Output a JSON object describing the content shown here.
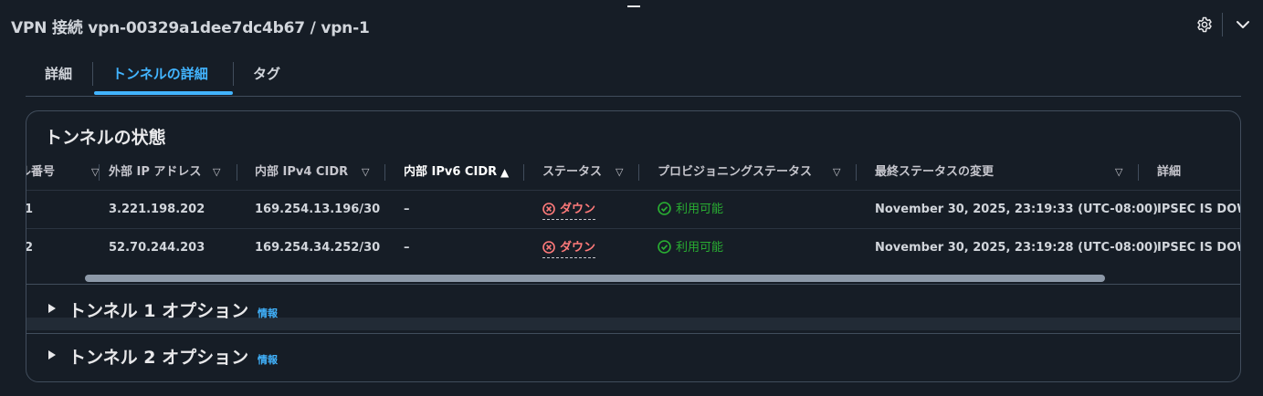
{
  "header": {
    "title": "VPN 接続 vpn-00329a1dee7dc4b67 / vpn-1",
    "icons": [
      "gear-icon",
      "chevron-down-icon"
    ]
  },
  "tabs": [
    {
      "label": "詳細"
    },
    {
      "label": "トンネルの詳細",
      "active": true
    },
    {
      "label": "タグ"
    }
  ],
  "tunnel_state": {
    "title": "トンネルの状態",
    "columns": [
      {
        "label": "ル番号"
      },
      {
        "label": "外部 IP アドレス"
      },
      {
        "label": "内部 IPv4 CIDR"
      },
      {
        "label": "内部 IPv6 CIDR",
        "sorted": "ascending"
      },
      {
        "label": "ステータス"
      },
      {
        "label": "プロビジョニングステータス"
      },
      {
        "label": "最終ステータスの変更"
      },
      {
        "label": "詳細"
      }
    ],
    "rows": [
      {
        "number": "1",
        "outside_ip": "3.221.198.202",
        "inside_ipv4": "169.254.13.196/30",
        "inside_ipv6": "–",
        "status": "ダウン",
        "provisioning": "利用可能",
        "last_change": "November 30, 2025, 23:19:33 (UTC-08:00)",
        "details": "IPSEC IS DOWN"
      },
      {
        "number": "2",
        "outside_ip": "52.70.244.203",
        "inside_ipv4": "169.254.34.252/30",
        "inside_ipv6": "–",
        "status": "ダウン",
        "provisioning": "利用可能",
        "last_change": "November 30, 2025, 23:19:28 (UTC-08:00)",
        "details": "IPSEC IS DOWN"
      }
    ]
  },
  "sections": [
    {
      "label": "トンネル 1 オプション",
      "info": "情報"
    },
    {
      "label": "トンネル 2 オプション",
      "info": "情報"
    }
  ],
  "colors": {
    "background": "#161d26",
    "accent": "#42b4ff",
    "error": "#ff7a7a",
    "success": "#29ad32",
    "border": "#414d5c"
  }
}
